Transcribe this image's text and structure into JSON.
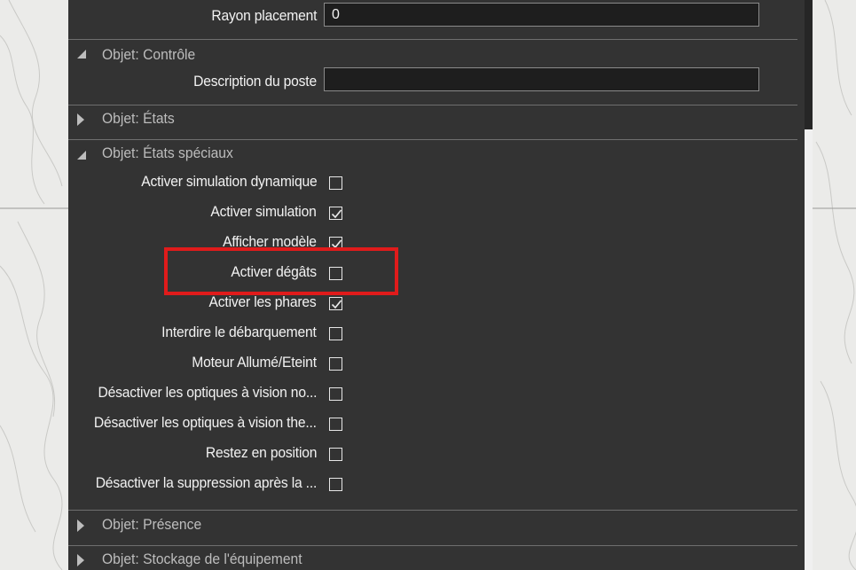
{
  "colors": {
    "panel": "#333333",
    "highlight": "#e01b1b",
    "text": "#f2f2f2",
    "section_text": "#bdbdbd"
  },
  "rayon": {
    "label": "Rayon placement",
    "value": "0"
  },
  "controle": {
    "title": "Objet: Contrôle",
    "description_label": "Description du poste",
    "description_value": ""
  },
  "etats": {
    "title": "Objet: États"
  },
  "etats_speciaux": {
    "title": "Objet: États spéciaux",
    "items": [
      {
        "label": "Activer simulation dynamique",
        "checked": false
      },
      {
        "label": "Activer simulation",
        "checked": true
      },
      {
        "label": "Afficher modèle",
        "checked": true
      },
      {
        "label": "Activer dégâts",
        "checked": false
      },
      {
        "label": "Activer les phares",
        "checked": true
      },
      {
        "label": "Interdire le débarquement",
        "checked": false
      },
      {
        "label": "Moteur Allumé/Eteint",
        "checked": false
      },
      {
        "label": "Désactiver les optiques à vision no...",
        "checked": false
      },
      {
        "label": "Désactiver les optiques à vision the...",
        "checked": false
      },
      {
        "label": "Restez en position",
        "checked": false
      },
      {
        "label": "Désactiver la suppression après la ...",
        "checked": false
      }
    ]
  },
  "presence": {
    "title": "Objet: Présence"
  },
  "stockage": {
    "title": "Objet: Stockage de l'équipement"
  }
}
